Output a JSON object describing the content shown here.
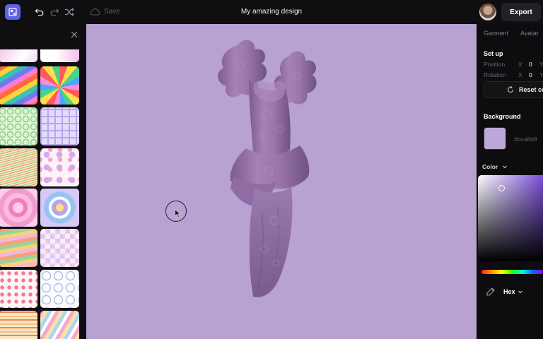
{
  "header": {
    "title": "My amazing design",
    "save_label": "Save",
    "export_label": "Export",
    "icons": [
      "app-logo-icon",
      "undo-icon",
      "redo-icon",
      "shuffle-icon",
      "cloud-icon"
    ]
  },
  "left_panel": {
    "close_icon": "close-icon",
    "patterns": [
      "pastel-gradient",
      "pastel-burst",
      "rainbow-waves",
      "rainbow-sunburst",
      "green-circles",
      "lilac-grid",
      "pastel-lines",
      "flower-pattern",
      "pink-flower",
      "lilac-flower",
      "retro-waves",
      "lilac-checker",
      "hearts-pattern",
      "smiley-pattern",
      "zigzag-pattern",
      "pastel-stripes"
    ]
  },
  "canvas": {
    "background": "#b7a2d2",
    "garment": "purple-ruffled-dress"
  },
  "right_panel": {
    "tabs": [
      "Garment",
      "Avatar"
    ],
    "setup": {
      "heading": "Set up",
      "position": {
        "label": "Position",
        "x_label": "X",
        "x_value": "0",
        "y_label": "Y"
      },
      "rotation": {
        "label": "Rotation",
        "x_label": "X",
        "x_value": "0",
        "y_label": "Y"
      },
      "reset_label": "Reset co"
    },
    "background": {
      "heading": "Background",
      "swatch_color": "#bca8d8",
      "hex_text": "#bca8d8",
      "color_label": "Color",
      "hex_mode_label": "Hex"
    }
  }
}
